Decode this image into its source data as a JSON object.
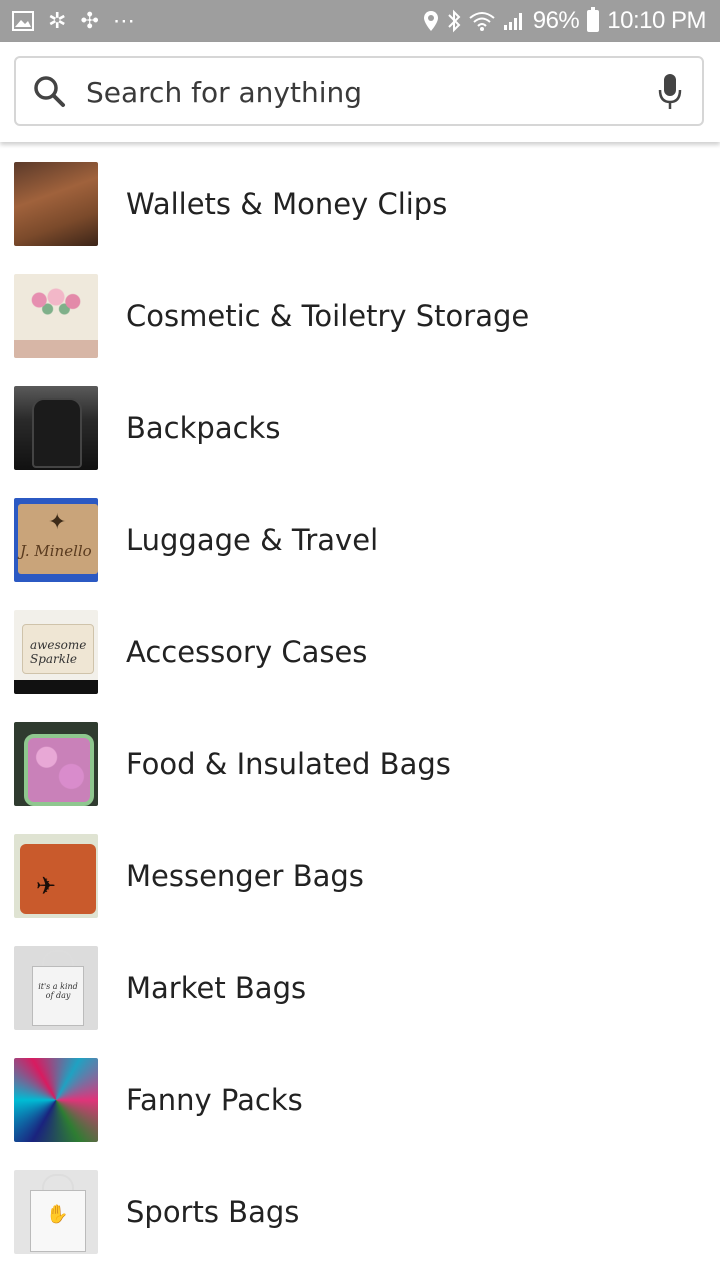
{
  "status_bar": {
    "left_icons": [
      "image-icon",
      "pinwheel-icon",
      "bluetooth-share-icon",
      "more-icon"
    ],
    "battery_percent": "96%",
    "time": "10:10 PM",
    "right_icons": [
      "location-icon",
      "bluetooth-icon",
      "wifi-icon",
      "signal-icon",
      "battery-icon"
    ]
  },
  "search": {
    "placeholder": "Search for anything",
    "value": ""
  },
  "categories": [
    {
      "label": "Wallets & Money Clips",
      "thumb": "wallet"
    },
    {
      "label": "Cosmetic & Toiletry Storage",
      "thumb": "cosmetic"
    },
    {
      "label": "Backpacks",
      "thumb": "backpack"
    },
    {
      "label": "Luggage & Travel",
      "thumb": "luggage",
      "thumb_text": "J. Minello"
    },
    {
      "label": "Accessory Cases",
      "thumb": "accessory",
      "thumb_text": "awesome Sparkle"
    },
    {
      "label": "Food & Insulated Bags",
      "thumb": "food"
    },
    {
      "label": "Messenger Bags",
      "thumb": "messenger"
    },
    {
      "label": "Market Bags",
      "thumb": "market",
      "thumb_text": "it's a kind of day"
    },
    {
      "label": "Fanny Packs",
      "thumb": "fanny"
    },
    {
      "label": "Sports Bags",
      "thumb": "sports"
    }
  ],
  "colors": {
    "status_bar_bg": "#9e9e9e",
    "text": "#222222",
    "search_border": "#d6d6d6"
  }
}
